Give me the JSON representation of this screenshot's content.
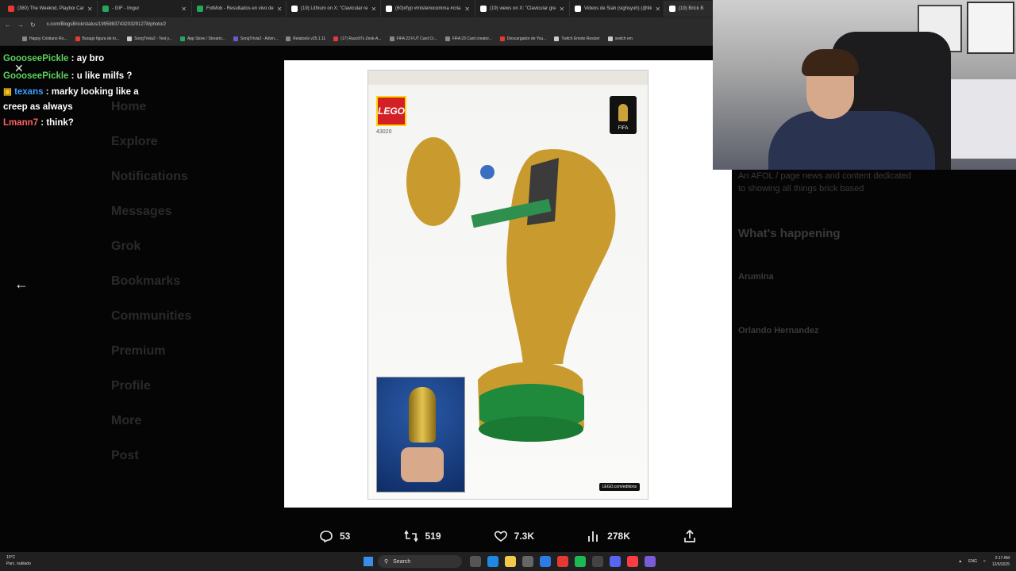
{
  "browser": {
    "tabs": [
      {
        "label": "(380) The Weeknd, Playboi Car",
        "color": "#e53935"
      },
      {
        "label": "- GIF - Imgur",
        "color": "#26a65b"
      },
      {
        "label": "FotMob - Resultados en vivo de",
        "color": "#26a65b"
      },
      {
        "label": "(19) Lithium on X: \"Clavicular re",
        "color": "#ffffff"
      },
      {
        "label": "(60)#fyp #misteriocomma #cria",
        "color": "#ffffff"
      },
      {
        "label": "(19) views on X: \"Clavicular gre",
        "color": "#ffffff"
      },
      {
        "label": "Videos de Siah (sighsyuh) (@tik",
        "color": "#ffffff"
      },
      {
        "label": "(19) Brick B",
        "color": "#ffffff"
      }
    ],
    "url": "x.com/BlogsBrick/status/1995983743203291278/photo/2",
    "bookmarks": [
      "Happy Cristiano Ro...",
      "Burago figura de to...",
      "SongTrivia2 - Test y...",
      "App Store / Streami...",
      "SongTrivia2 - Advin...",
      "Relatools v25.1.11",
      "(17) Razo97s Zesk-A...",
      "FIFA 23 FUT Card Cr...",
      "FIFA 23 Card creator...",
      "Descargador de You...",
      "Twitch Emote Resizer",
      "switch em"
    ]
  },
  "chat": [
    {
      "user": "GoooseePickle",
      "msg": " : ay bro",
      "color": "#5cd35c"
    },
    {
      "user": "GoooseePickle",
      "msg": " : u like milfs ?",
      "color": "#5cd35c"
    },
    {
      "user": "texans",
      "msg": " : marky looking like a creep as always",
      "color": "#3aa0ff",
      "badge": true
    },
    {
      "user": "Lmann7",
      "msg": " : think?",
      "color": "#ff6060"
    }
  ],
  "sidebar_dim": [
    "Home",
    "Explore",
    "Notifications",
    "Messages",
    "Grok",
    "Bookmarks",
    "Communities",
    "Premium",
    "Profile",
    "More",
    "Post"
  ],
  "product": {
    "brand": "LEGO",
    "set_number": "43020",
    "fifa_label": "FIFA",
    "url_badge": "LEGO.com/editions"
  },
  "actions": {
    "replies": "53",
    "reposts": "519",
    "likes": "7.3K",
    "views": "278K"
  },
  "right_dim": {
    "bio": "An AFOL / page news and content dedicated to showing all things brick based",
    "heading": "What's happening",
    "trends": [
      "Arumina",
      "Orlando Hernandez"
    ]
  },
  "taskbar": {
    "weather_temp": "10°C",
    "weather_desc": "Parc. nublado",
    "search": "Search",
    "lang": "ENG",
    "time": "2:17 AM",
    "date": "12/5/2025"
  }
}
